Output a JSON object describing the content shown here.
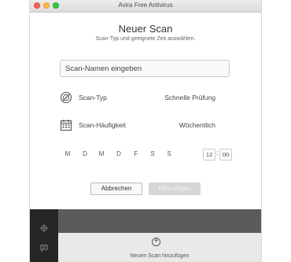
{
  "window": {
    "title": "Avira Free Antivirus"
  },
  "dialog": {
    "heading": "Neuer Scan",
    "subheading": "Scan-Typ und geeignete Zeit auswählen.",
    "name_placeholder": "Scan-Namen eingeben",
    "scan_type": {
      "label": "Scan-Typ",
      "value": "Schnelle Prüfung",
      "icon": "scan-target-icon"
    },
    "frequency": {
      "label": "Scan-Häufigkeit",
      "value": "Wöchentlich",
      "icon": "calendar-icon"
    },
    "days": [
      "M",
      "D",
      "M",
      "D",
      "F",
      "S",
      "S"
    ],
    "time": {
      "hours": "12",
      "minutes": "00",
      "separator": ":"
    },
    "cancel_label": "Abbrechen",
    "add_label": "Hinzufügen"
  },
  "bottom": {
    "add_scan_label": "Neuen Scan hinzufügen",
    "sidebar_icons": [
      "gear-icon",
      "chat-icon"
    ]
  },
  "colors": {
    "sidebar": "#252525",
    "strip": "#5b5b5b",
    "disabled_button": "#d6d6d6"
  }
}
